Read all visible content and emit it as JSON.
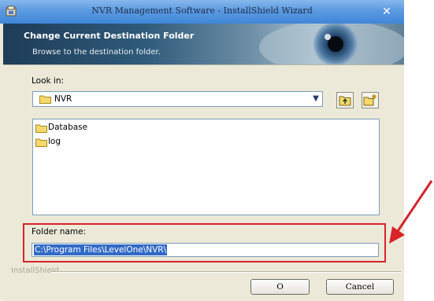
{
  "window": {
    "title": "NVR Management Software - InstallShield Wizard",
    "close_glyph": "✕"
  },
  "banner": {
    "title": "Change Current Destination Folder",
    "subtitle": "Browse to the destination folder."
  },
  "look_in": {
    "label": "Look in:",
    "value": "NVR"
  },
  "folders": [
    {
      "name": "Database"
    },
    {
      "name": "log"
    }
  ],
  "folder_name": {
    "label": "Folder name:",
    "value": "C:\\Program Files\\LevelOne\\NVR\\"
  },
  "footer": {
    "brand": "InstallShield"
  },
  "buttons": {
    "ok": "O",
    "cancel": "Cancel"
  },
  "colors": {
    "accent": "#316ac5",
    "annotation": "#d8232a",
    "titlebar": "#4a8fdc"
  }
}
